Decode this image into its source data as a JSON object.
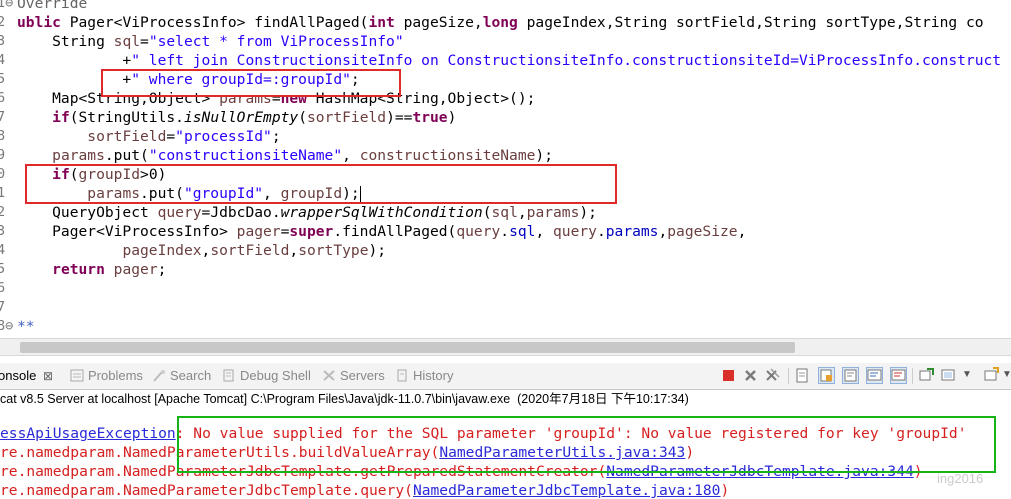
{
  "editor": {
    "line_numbers": [
      "1⊖",
      "2",
      "3",
      "4",
      "5",
      "6",
      "7",
      "8",
      "9",
      "0",
      "1",
      "2",
      "3",
      "4",
      "5",
      "6",
      "7",
      "8⊖"
    ],
    "lines": [
      {
        "segments": [
          {
            "t": "Override",
            "c": "ann"
          }
        ]
      },
      {
        "segments": [
          {
            "t": "ublic",
            "c": "kw"
          },
          {
            "t": " Pager<ViProcessInfo> findAllPaged("
          },
          {
            "t": "int",
            "c": "kw"
          },
          {
            "t": " pageSize,"
          },
          {
            "t": "long",
            "c": "kw"
          },
          {
            "t": " pageIndex,String sortField,String sortType,String co"
          }
        ]
      },
      {
        "segments": [
          {
            "t": "    String "
          },
          {
            "t": "sql",
            "c": "var"
          },
          {
            "t": "="
          },
          {
            "t": "\"select * from ViProcessInfo\"",
            "c": "str"
          }
        ]
      },
      {
        "segments": [
          {
            "t": "            +"
          },
          {
            "t": "\" left join ConstructionsiteInfo on ConstructionsiteInfo.constructionsiteId=ViProcessInfo.construct",
            "c": "str"
          }
        ]
      },
      {
        "segments": [
          {
            "t": "            +"
          },
          {
            "t": "\" where groupId=:groupId\"",
            "c": "str"
          },
          {
            "t": ";"
          }
        ]
      },
      {
        "segments": [
          {
            "t": "    Map<String,Object> "
          },
          {
            "t": "params",
            "c": "var"
          },
          {
            "t": "="
          },
          {
            "t": "new",
            "c": "kw"
          },
          {
            "t": " HashMap<String,Object>();"
          }
        ]
      },
      {
        "segments": [
          {
            "t": "    "
          },
          {
            "t": "if",
            "c": "kw"
          },
          {
            "t": "(StringUtils."
          },
          {
            "t": "isNullOrEmpty",
            "c": "it"
          },
          {
            "t": "("
          },
          {
            "t": "sortField",
            "c": "var"
          },
          {
            "t": ")=="
          },
          {
            "t": "true",
            "c": "kw"
          },
          {
            "t": ")"
          }
        ]
      },
      {
        "segments": [
          {
            "t": "        "
          },
          {
            "t": "sortField",
            "c": "var"
          },
          {
            "t": "="
          },
          {
            "t": "\"processId\"",
            "c": "str"
          },
          {
            "t": ";"
          }
        ]
      },
      {
        "segments": [
          {
            "t": "    "
          },
          {
            "t": "params",
            "c": "var"
          },
          {
            "t": ".put("
          },
          {
            "t": "\"constructionsiteName\"",
            "c": "str"
          },
          {
            "t": ", "
          },
          {
            "t": "constructionsiteName",
            "c": "var"
          },
          {
            "t": ");"
          }
        ]
      },
      {
        "segments": [
          {
            "t": "    "
          },
          {
            "t": "if",
            "c": "kw"
          },
          {
            "t": "("
          },
          {
            "t": "groupId",
            "c": "var"
          },
          {
            "t": ">0)"
          }
        ]
      },
      {
        "segments": [
          {
            "t": "        "
          },
          {
            "t": "params",
            "c": "var"
          },
          {
            "t": ".put("
          },
          {
            "t": "\"groupId\"",
            "c": "str"
          },
          {
            "t": ", "
          },
          {
            "t": "groupId",
            "c": "var"
          },
          {
            "t": ");"
          }
        ],
        "cursor": true
      },
      {
        "segments": [
          {
            "t": "    QueryObject "
          },
          {
            "t": "query",
            "c": "var"
          },
          {
            "t": "=JdbcDao."
          },
          {
            "t": "wrapperSqlWithCondition",
            "c": "it"
          },
          {
            "t": "("
          },
          {
            "t": "sql",
            "c": "var"
          },
          {
            "t": ","
          },
          {
            "t": "params",
            "c": "var"
          },
          {
            "t": ");"
          }
        ]
      },
      {
        "segments": [
          {
            "t": "    Pager<ViProcessInfo> "
          },
          {
            "t": "pager",
            "c": "var"
          },
          {
            "t": "="
          },
          {
            "t": "super",
            "c": "kw"
          },
          {
            "t": ".findAllPaged("
          },
          {
            "t": "query",
            "c": "var"
          },
          {
            "t": "."
          },
          {
            "t": "sql",
            "c": "fld"
          },
          {
            "t": ", "
          },
          {
            "t": "query",
            "c": "var"
          },
          {
            "t": "."
          },
          {
            "t": "params",
            "c": "fld"
          },
          {
            "t": ","
          },
          {
            "t": "pageSize",
            "c": "var"
          },
          {
            "t": ","
          }
        ]
      },
      {
        "segments": [
          {
            "t": "            "
          },
          {
            "t": "pageIndex",
            "c": "var"
          },
          {
            "t": ","
          },
          {
            "t": "sortField",
            "c": "var"
          },
          {
            "t": ","
          },
          {
            "t": "sortType",
            "c": "var"
          },
          {
            "t": ");"
          }
        ]
      },
      {
        "segments": [
          {
            "t": "    "
          },
          {
            "t": "return",
            "c": "kw"
          },
          {
            "t": " "
          },
          {
            "t": "pager",
            "c": "var"
          },
          {
            "t": ";"
          }
        ]
      },
      {
        "segments": []
      },
      {
        "segments": []
      },
      {
        "segments": [
          {
            "t": "**",
            "c": "cmt"
          }
        ]
      }
    ]
  },
  "tabs": [
    {
      "label": "onsole",
      "icon": "console-icon",
      "active": true
    },
    {
      "label": "Problems",
      "icon": "problems-icon"
    },
    {
      "label": "Search",
      "icon": "search-icon"
    },
    {
      "label": "Debug Shell",
      "icon": "debug-shell-icon"
    },
    {
      "label": "Servers",
      "icon": "servers-icon"
    },
    {
      "label": "History",
      "icon": "history-icon"
    }
  ],
  "status_line": "cat v8.5 Server at localhost [Apache Tomcat] C:\\Program Files\\Java\\jdk-11.0.7\\bin\\javaw.exe  (2020年7月18日 下午10:17:34)",
  "console": {
    "lines": [
      {
        "segments": []
      },
      {
        "segments": [
          {
            "t": "essApiUsageException",
            "c": "link"
          },
          {
            "t": ": No value supplied for the SQL parameter 'groupId': No value registered for key 'groupId'"
          }
        ]
      },
      {
        "segments": [
          {
            "t": "re.namedparam.NamedParameterUtils.buildValueArray("
          },
          {
            "t": "NamedParameterUtils.java:343",
            "c": "link"
          },
          {
            "t": ")"
          }
        ]
      },
      {
        "segments": [
          {
            "t": "re.namedparam.NamedParameterJdbcTemplate.getPreparedStatementCreator("
          },
          {
            "t": "NamedParameterJdbcTemplate.java:344",
            "c": "link"
          },
          {
            "t": ")"
          }
        ]
      },
      {
        "segments": [
          {
            "t": "re.namedparam.NamedParameterJdbcTemplate.query("
          },
          {
            "t": "NamedParameterJdbcTemplate.java:180",
            "c": "link"
          },
          {
            "t": ")"
          }
        ]
      }
    ]
  },
  "watermark": "ing2016",
  "colors": {
    "highlight_red": "#e02a2a",
    "highlight_green": "#16b316",
    "keyword": "#7f0055",
    "string": "#2a00ff",
    "error": "#d61f1f"
  }
}
